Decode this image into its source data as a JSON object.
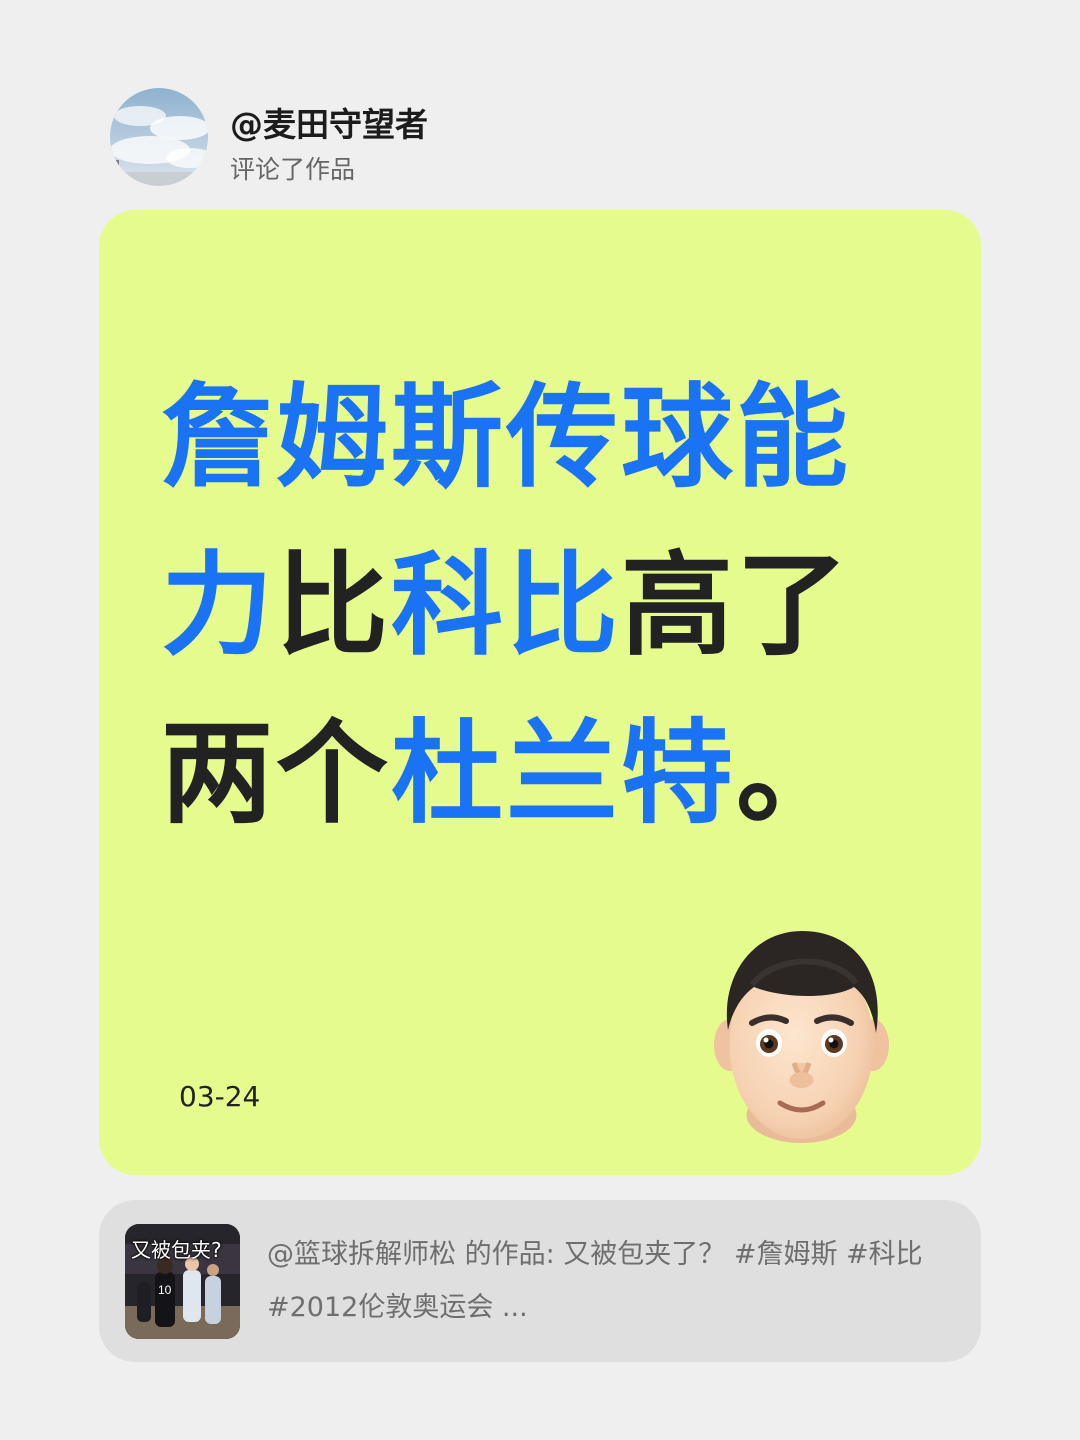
{
  "author": {
    "avatar_icon": "sky-clouds-avatar",
    "username": "@麦田守望者",
    "action": "评论了作品"
  },
  "comment_card": {
    "background": "#e6fb8e",
    "segments": [
      {
        "text": "詹姆斯传球能力",
        "highlight": true
      },
      {
        "text": "比",
        "highlight": false
      },
      {
        "text": "科比",
        "highlight": true
      },
      {
        "text": "高了两个",
        "highlight": false
      },
      {
        "text": "杜兰特",
        "highlight": true
      },
      {
        "text": "。",
        "highlight": false
      }
    ],
    "highlight_color": "#1a72f4",
    "text_color": "#222222",
    "date": "03-24",
    "emoji_icon": "man-face-emoji"
  },
  "source_work": {
    "thumbnail_caption": "又被包夹?",
    "text": "@篮球拆解师松 的作品: 又被包夹了？ #詹姆斯 #科比 #2012伦敦奥运会 ..."
  }
}
